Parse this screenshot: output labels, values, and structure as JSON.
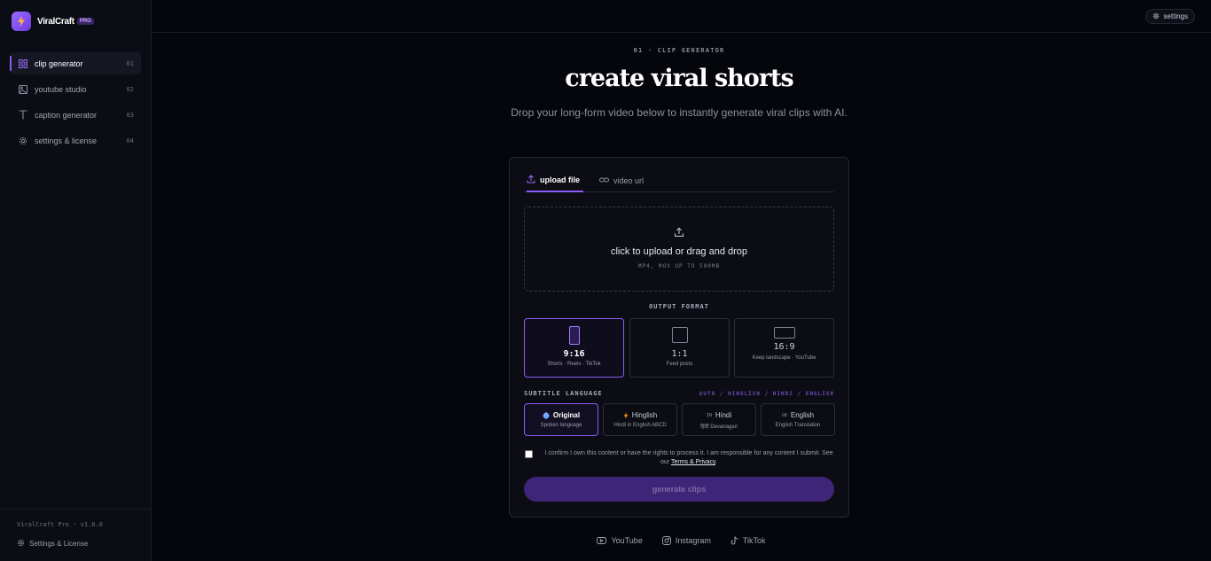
{
  "brand": {
    "name": "ViralCraft",
    "badge": "PRO"
  },
  "sidebar": {
    "items": [
      {
        "label": "clip generator",
        "num": "01",
        "icon": "grid-icon",
        "active": true
      },
      {
        "label": "youtube studio",
        "num": "02",
        "icon": "image-icon",
        "active": false
      },
      {
        "label": "caption generator",
        "num": "03",
        "icon": "text-icon",
        "active": false
      },
      {
        "label": "settings & license",
        "num": "04",
        "icon": "gear-icon",
        "active": false
      }
    ],
    "version": "ViralCraft Pro · v1.0.0",
    "footer_link": "Settings & License"
  },
  "topbar": {
    "settings_label": "settings"
  },
  "main": {
    "eyebrow": "01 · CLIP GENERATOR",
    "title": "create viral shorts",
    "subtitle": "Drop your long-form video below to instantly generate viral clips with AI."
  },
  "card": {
    "tabs": [
      {
        "label": "upload file",
        "active": true,
        "icon": "upload-icon"
      },
      {
        "label": "video url",
        "active": false,
        "icon": "link-icon"
      }
    ],
    "dropzone": {
      "title": "click to upload or drag and drop",
      "hint": "MP4, MOV UP TO 500MB"
    },
    "output_format": {
      "label": "OUTPUT FORMAT",
      "options": [
        {
          "ratio": "9:16",
          "desc": "Shorts · Reels · TikTok",
          "active": true
        },
        {
          "ratio": "1:1",
          "desc": "Feed posts",
          "active": false
        },
        {
          "ratio": "16:9",
          "desc": "Keep landscape · YouTube",
          "active": false
        }
      ]
    },
    "subtitle_language": {
      "label": "SUBTITLE LANGUAGE",
      "modes": "AUTO / HINGLISH / HINDI / ENGLISH",
      "options": [
        {
          "tag": "",
          "name": "Original",
          "desc": "Spoken language",
          "active": true
        },
        {
          "tag": "",
          "name": "Hinglish",
          "desc": "Hindi in English ABCD",
          "active": false
        },
        {
          "tag": "IN",
          "name": "Hindi",
          "desc": "हिंदी Devanagari",
          "active": false
        },
        {
          "tag": "GB",
          "name": "English",
          "desc": "English Translation",
          "active": false
        }
      ]
    },
    "consent": {
      "text": "I confirm I own this content or have the rights to process it. I am responsible for any content I submit. See our ",
      "link": "Terms & Privacy",
      "end": "."
    },
    "generate_label": "generate clips"
  },
  "socials": [
    {
      "label": "YouTube",
      "icon": "youtube-icon"
    },
    {
      "label": "Instagram",
      "icon": "instagram-icon"
    },
    {
      "label": "TikTok",
      "icon": "tiktok-icon"
    }
  ],
  "colors": {
    "accent": "#8b5cf6",
    "background": "#05060b",
    "button": "#3f2577"
  }
}
